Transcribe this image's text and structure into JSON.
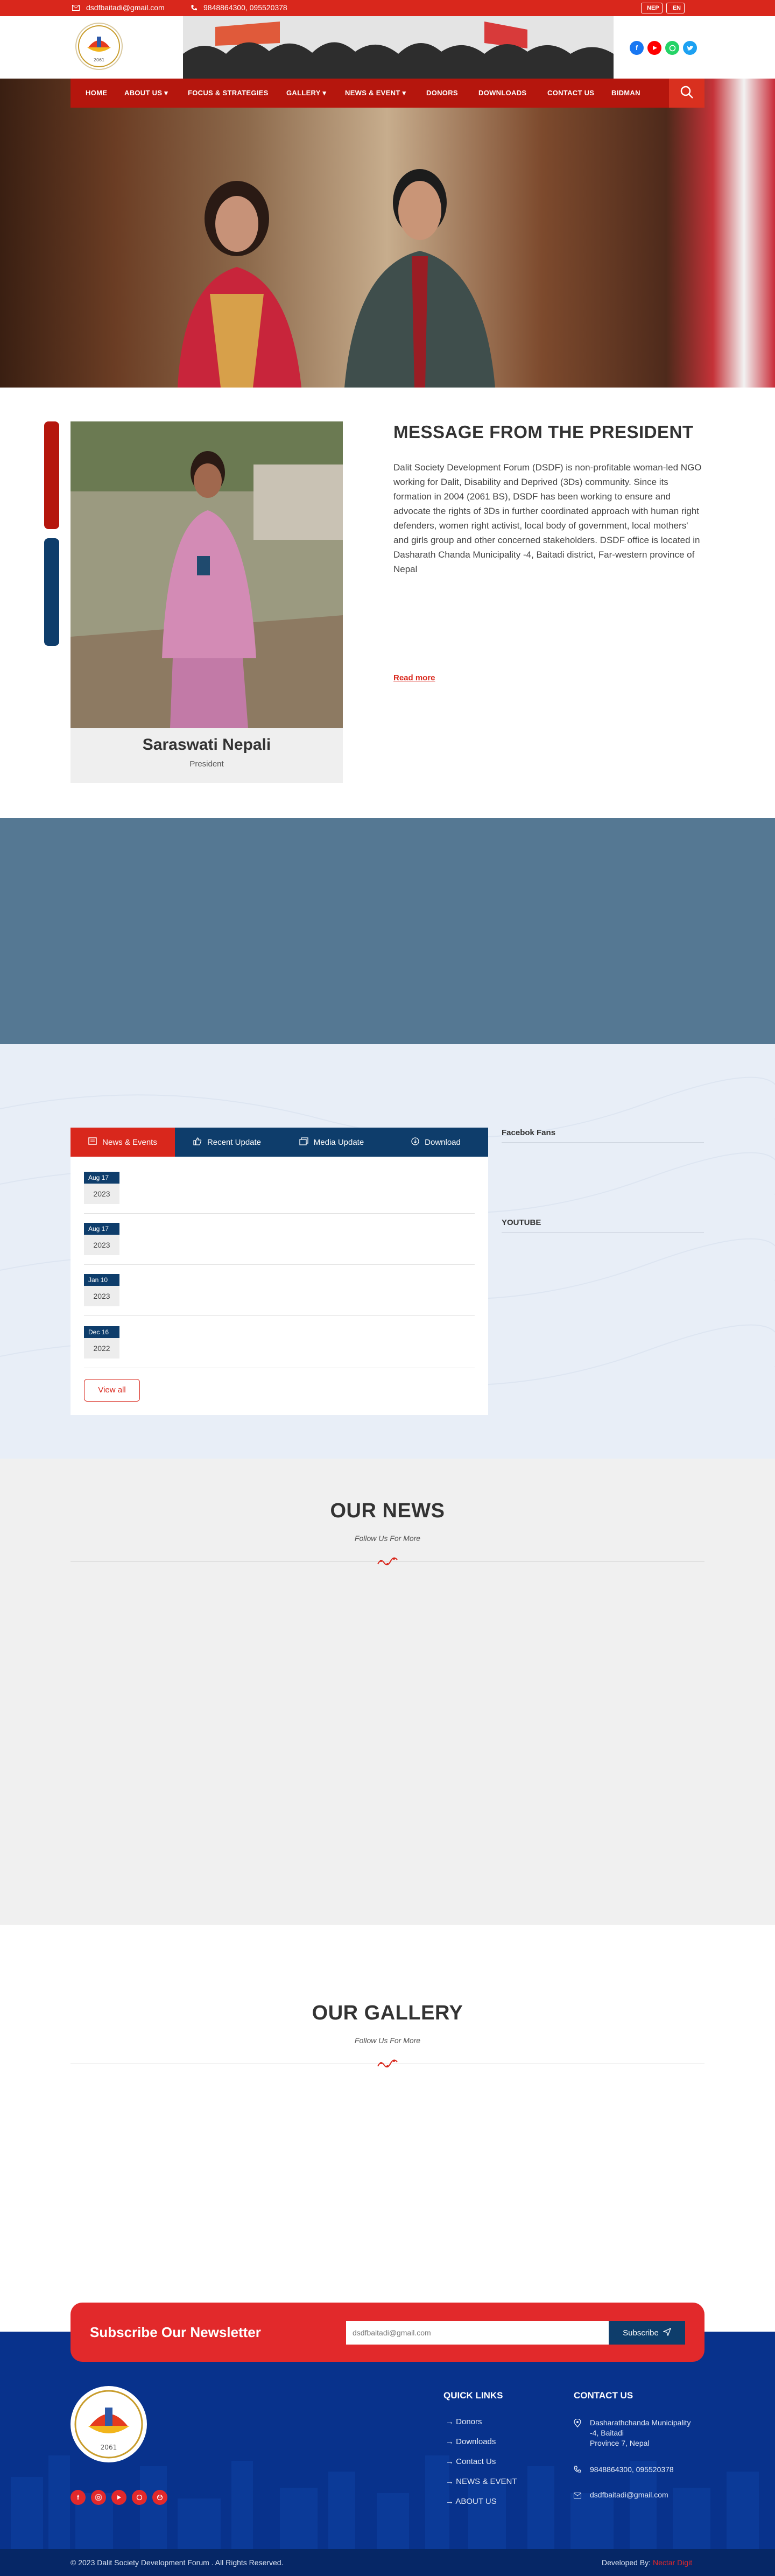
{
  "topbar": {
    "email": "dsdfbaitadi@gmail.com",
    "phone": "9848864300, 095520378",
    "lang_nep": "NEP",
    "lang_en": "EN"
  },
  "social": [
    "f",
    "yt",
    "wa",
    "tw"
  ],
  "nav": {
    "items": [
      "HOME",
      "ABOUT US",
      "FOCUS & STRATEGIES",
      "GALLERY",
      "NEWS & EVENT",
      "DONORS",
      "DOWNLOADS",
      "CONTACT US",
      "BIDMAN"
    ],
    "dropdown_marker": "▾"
  },
  "president": {
    "heading": "MESSAGE FROM THE PRESIDENT",
    "body": "Dalit Society Development Forum (DSDF) is non-profitable woman-led NGO working for Dalit, Disability and Deprived (3Ds) community. Since its formation in 2004 (2061 BS), DSDF has been working to ensure and advocate the rights of 3Ds in further coordinated approach with  human right defenders, women right activist, local body of government, local mothers' and girls group and other concerned stakeholders. DSDF office is located in Dasharath Chanda Municipality -4, Baitadi district, Far-western province of Nepal",
    "read_more": "Read more",
    "name": "Saraswati Nepali",
    "role": "President"
  },
  "tabs": {
    "items": [
      "News & Events",
      "Recent Update",
      "Media Update",
      "Download"
    ],
    "news": [
      {
        "date": "Aug 17",
        "year": "2023"
      },
      {
        "date": "Aug 17",
        "year": "2023"
      },
      {
        "date": "Jan 10",
        "year": "2023"
      },
      {
        "date": "Dec 16",
        "year": "2022"
      }
    ],
    "view_all": "View all"
  },
  "widgets": {
    "facebook": "Facebok Fans",
    "youtube": "YOUTUBE"
  },
  "our_news": {
    "title": "OUR NEWS",
    "subtitle": "Follow Us For More"
  },
  "our_gallery": {
    "title": "OUR GALLERY",
    "subtitle": "Follow Us For More"
  },
  "newsletter": {
    "title": "Subscribe Our Newsletter",
    "placeholder": "dsdfbaitadi@gmail.com",
    "button": "Subscribe"
  },
  "footer": {
    "quick_links_title": "QUICK LINKS",
    "quick_links": [
      "Donors",
      "Downloads",
      "Contact Us",
      "NEWS & EVENT",
      "ABOUT US"
    ],
    "contact_title": "CONTACT US",
    "address_lines": [
      "Dasharathchanda Municipality",
      "-4, Baitadi",
      "Province 7, Nepal"
    ],
    "phone": "9848864300, 095520378",
    "email": "dsdfbaitadi@gmail.com",
    "copyright": "© 2023 Dalit Society Development Forum . All Rights Reserved.",
    "developed_label": "Developed By:",
    "developer": "Nectar Digit"
  },
  "colors": {
    "primary_red": "#d9271c",
    "nav_red": "#b5160d",
    "navy": "#0e3d6b",
    "footer_blue": "#08328c"
  }
}
